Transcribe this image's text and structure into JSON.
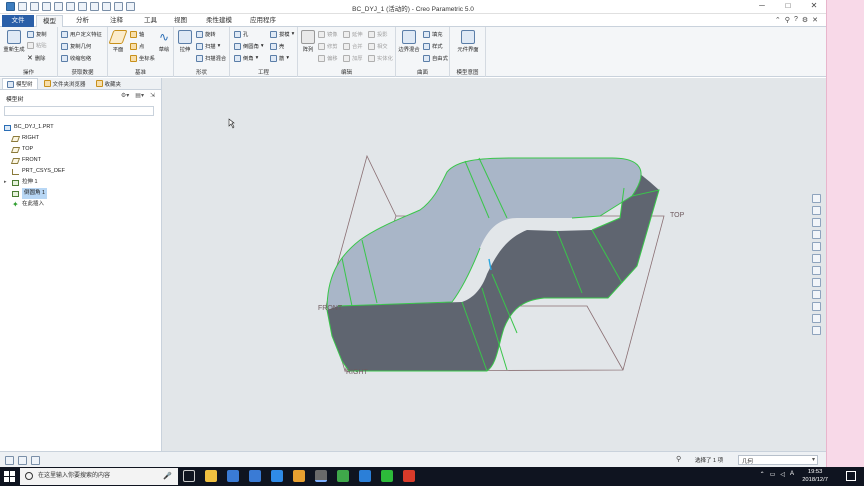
{
  "window": {
    "title": "BC_DYJ_1 (活动的) - Creo Parametric 5.0"
  },
  "tabs": [
    {
      "label": "文件"
    },
    {
      "label": "模型"
    },
    {
      "label": "分析"
    },
    {
      "label": "注释"
    },
    {
      "label": "工具"
    },
    {
      "label": "视图"
    },
    {
      "label": "柔性建模"
    },
    {
      "label": "应用程序"
    }
  ],
  "ribbon": {
    "groups": {
      "operations": {
        "name": "操作",
        "regen": "重新生成",
        "copy": "复制",
        "paste": "粘贴",
        "delete": "删除"
      },
      "getdata": {
        "name": "获取数据",
        "udf": "用户定义特征",
        "copygeom": "复制几何",
        "shrinkwrap": "收缩包络"
      },
      "datum": {
        "name": "基准",
        "plane": "平面",
        "axis": "轴",
        "point": "点",
        "csys": "坐标系",
        "sketch": "草绘"
      },
      "shapes": {
        "name": "形状",
        "extrude": "拉伸",
        "revolve": "旋转",
        "sweep": "扫描",
        "blendsweep": "扫描混合"
      },
      "engineering": {
        "name": "工程",
        "hole": "孔",
        "round": "倒圆角",
        "chamfer": "倒角",
        "draft": "拔模",
        "shell": "壳",
        "rib": "筋"
      },
      "editing": {
        "name": "编辑",
        "pattern": "阵列",
        "mirror": "镜像",
        "extend": "延伸",
        "project": "投影",
        "trim": "修剪",
        "merge": "合并",
        "intersect": "相交",
        "offset": "偏移",
        "thicken": "加厚",
        "solidify": "实体化"
      },
      "surfaces": {
        "name": "曲面",
        "boundary": "边界混合",
        "fill": "填充",
        "style": "样式",
        "freestyle": "自由式"
      },
      "intent": {
        "name": "模型意图",
        "component": "元件界面"
      }
    }
  },
  "navigator": {
    "tabs": [
      "模型树",
      "文件夹浏览器",
      "收藏夹"
    ],
    "header": "模型树",
    "tree": [
      {
        "label": "BC_DYJ_1.PRT",
        "kind": "part"
      },
      {
        "label": "RIGHT",
        "kind": "plane"
      },
      {
        "label": "TOP",
        "kind": "plane"
      },
      {
        "label": "FRONT",
        "kind": "plane"
      },
      {
        "label": "PRT_CSYS_DEF",
        "kind": "csys"
      },
      {
        "label": "拉伸 1",
        "kind": "feature"
      },
      {
        "label": "倒圆角 1",
        "kind": "feature",
        "selected": true
      },
      {
        "label": "在此插入",
        "kind": "insert"
      }
    ]
  },
  "viewport": {
    "labels": {
      "top": "TOP",
      "front": "FRONT",
      "right": "RIGHT"
    }
  },
  "statusbar": {
    "message": "选择了 1 项",
    "filter": "几何"
  },
  "taskbar": {
    "search_placeholder": "在这里输入你要搜索的内容",
    "time": "19:53",
    "date": "2018/12/7",
    "ime": "A"
  },
  "colors": {
    "file_tab": "#2a5fa8",
    "solid_top": "#a9b6c8",
    "solid_side": "#5f6570",
    "edge": "#39c64a",
    "datum": "#8a6f73"
  }
}
